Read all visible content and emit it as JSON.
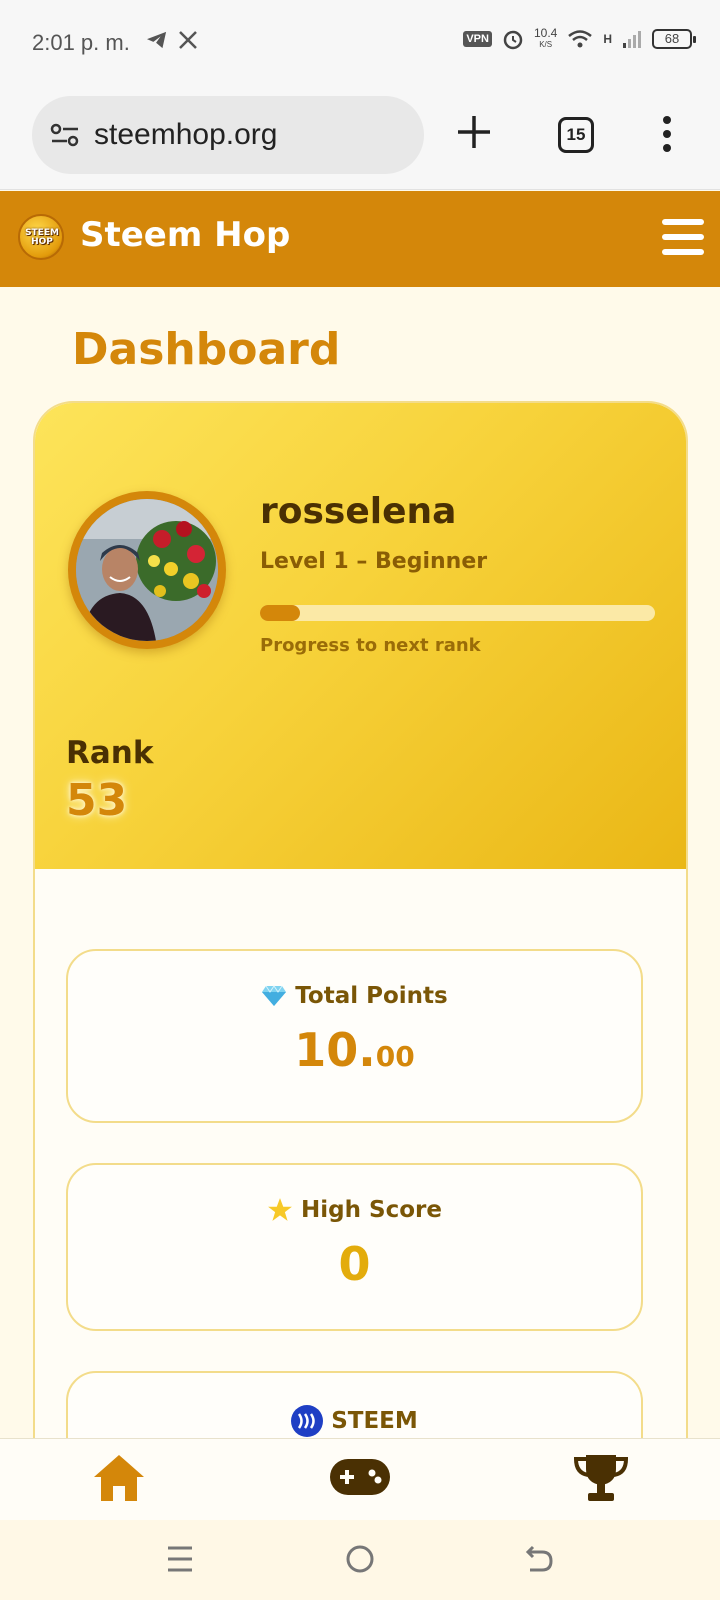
{
  "status_bar": {
    "time": "2:01 p. m.",
    "vpn": "VPN",
    "speed_value": "10.4",
    "speed_unit": "K/S",
    "network": "H",
    "battery": "68"
  },
  "browser": {
    "url": "steemhop.org",
    "tab_count": "15"
  },
  "app": {
    "brand": "Steem Hop",
    "logo_text_1": "STEEM",
    "logo_text_2": "HOP"
  },
  "dashboard": {
    "title": "Dashboard",
    "profile": {
      "username": "rosselena",
      "level": "Level 1 – Beginner",
      "progress_fraction": 0.1,
      "progress_label": "Progress to next rank"
    },
    "rank": {
      "label": "Rank",
      "value": "53"
    },
    "stats": [
      {
        "icon": "gem-icon",
        "label": "Total Points",
        "value_int": "10.",
        "value_dec": "00"
      },
      {
        "icon": "star-icon",
        "label": "High Score",
        "value": "0"
      },
      {
        "icon": "steem-icon",
        "label": "STEEM"
      }
    ]
  },
  "bottom_nav": {
    "items": [
      "home-icon",
      "gamepad-icon",
      "trophy-icon"
    ],
    "active": "home-icon"
  },
  "colors": {
    "brand_orange": "#d4870a",
    "hero_yellow": "#f7d23a",
    "page_bg": "#fffaea"
  }
}
